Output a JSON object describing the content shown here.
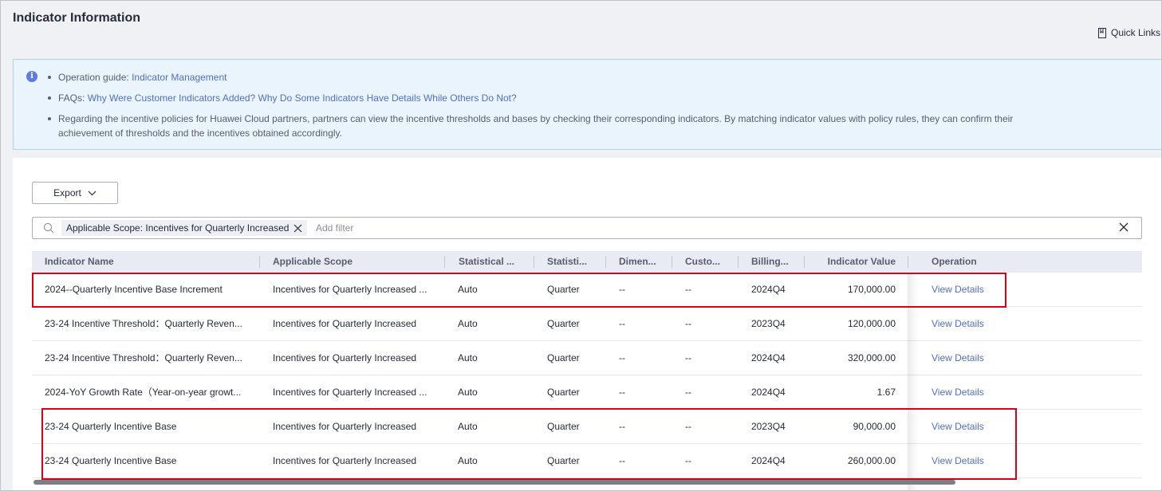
{
  "page": {
    "title": "Indicator Information",
    "quick_links": "Quick Links"
  },
  "banner": {
    "info_icon": "i",
    "guide_prefix": "Operation guide: ",
    "guide_link": "Indicator Management",
    "faq_prefix": "FAQs: ",
    "faq_link": "Why Were Customer Indicators Added? Why Do Some Indicators Have Details While Others Do Not?",
    "policy_text": "Regarding the incentive policies for Huawei Cloud partners, partners can view the incentive thresholds and bases by checking their corresponding indicators. By matching indicator values with policy rules, they can confirm their achievement of thresholds and the incentives obtained accordingly."
  },
  "toolbar": {
    "export_label": "Export"
  },
  "filter": {
    "tag_label": "Applicable Scope: Incentives for Quarterly Increased",
    "placeholder": "Add filter"
  },
  "table": {
    "columns": [
      "Indicator Name",
      "Applicable Scope",
      "Statistical ...",
      "Statisti...",
      "Dimen...",
      "Custo...",
      "Billing...",
      "Indicator Value",
      "Operation"
    ],
    "rows": [
      {
        "name": "2024--Quarterly Incentive Base Increment",
        "scope": "Incentives for Quarterly Increased ...",
        "stat_method": "Auto",
        "stat_period": "Quarter",
        "dimension": "--",
        "customer": "--",
        "billing": "2024Q4",
        "value": "170,000.00",
        "action": "View Details"
      },
      {
        "name": "23-24 Incentive Threshold：Quarterly Reven...",
        "scope": "Incentives for Quarterly Increased",
        "stat_method": "Auto",
        "stat_period": "Quarter",
        "dimension": "--",
        "customer": "--",
        "billing": "2023Q4",
        "value": "120,000.00",
        "action": "View Details"
      },
      {
        "name": "23-24 Incentive Threshold：Quarterly Reven...",
        "scope": "Incentives for Quarterly Increased",
        "stat_method": "Auto",
        "stat_period": "Quarter",
        "dimension": "--",
        "customer": "--",
        "billing": "2024Q4",
        "value": "320,000.00",
        "action": "View Details"
      },
      {
        "name": "2024-YoY Growth Rate（Year-on-year growt...",
        "scope": "Incentives for Quarterly Increased ...",
        "stat_method": "Auto",
        "stat_period": "Quarter",
        "dimension": "--",
        "customer": "--",
        "billing": "2024Q4",
        "value": "1.67",
        "action": "View Details"
      },
      {
        "name": "23-24 Quarterly Incentive Base",
        "scope": "Incentives for Quarterly Increased",
        "stat_method": "Auto",
        "stat_period": "Quarter",
        "dimension": "--",
        "customer": "--",
        "billing": "2023Q4",
        "value": "90,000.00",
        "action": "View Details"
      },
      {
        "name": "23-24 Quarterly Incentive Base",
        "scope": "Incentives for Quarterly Increased",
        "stat_method": "Auto",
        "stat_period": "Quarter",
        "dimension": "--",
        "customer": "--",
        "billing": "2024Q4",
        "value": "260,000.00",
        "action": "View Details"
      }
    ]
  },
  "colors": {
    "link": "#526ecc",
    "banner_bg": "#eaf4fd",
    "highlight": "#d9001b",
    "header_bg": "#e8ebf3"
  }
}
